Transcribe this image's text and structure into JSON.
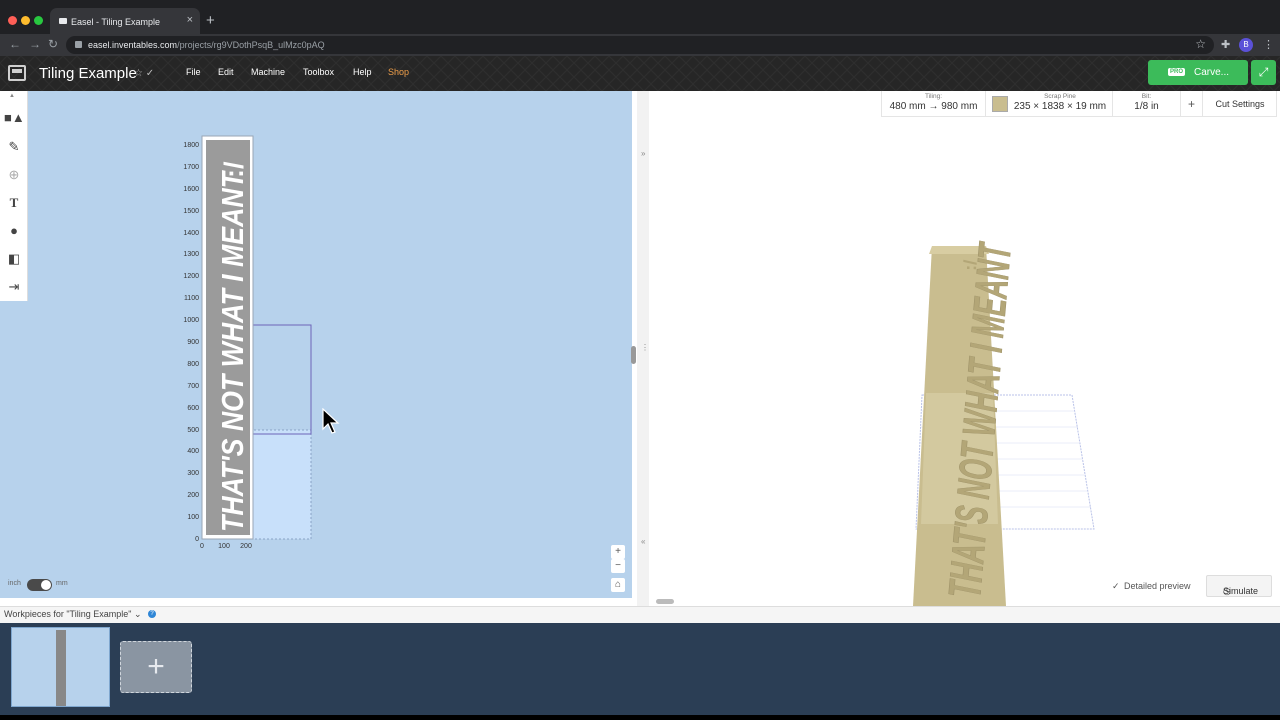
{
  "browser": {
    "tab_title": "Easel - Tiling Example",
    "tab_close": "×",
    "new_tab": "+",
    "url_host": "easel.inventables.com",
    "url_path": "/projects/rg9VDothPsqB_ulMzc0pAQ",
    "profile_initial": "B"
  },
  "app": {
    "project_title": "Tiling Example",
    "menu": [
      "File",
      "Edit",
      "Machine",
      "Toolbox",
      "Help",
      "Shop"
    ],
    "carve_pro": "PRO",
    "carve_label": "Carve..."
  },
  "info_bar": {
    "tiling_label": "Tiling:",
    "tiling_value": "480 mm → 980 mm",
    "material_label": "Scrap Pine",
    "material_value": "235 × 1838 × 19 mm",
    "bit_label": "Bit:",
    "bit_value": "1/8 in",
    "add_label": "+",
    "cut_settings": "Cut Settings"
  },
  "canvas": {
    "design_text": "THAT'S NOT WHAT I MEANT",
    "face_text": ":/",
    "y_ticks": [
      "1800",
      "1700",
      "1600",
      "1500",
      "1400",
      "1300",
      "1200",
      "1100",
      "1000",
      "900",
      "800",
      "700",
      "600",
      "500",
      "400",
      "300",
      "200",
      "100",
      "0"
    ],
    "x_ticks": [
      "0",
      "100",
      "200"
    ],
    "unit_inch": "inch",
    "unit_mm": "mm",
    "zoom_in": "+",
    "zoom_out": "−"
  },
  "preview": {
    "detailed_preview": "Detailed preview",
    "simulate": "Simulate",
    "wood_color": "#c9bd8f"
  },
  "workpieces": {
    "label": "Workpieces for \"Tiling Example\"",
    "help": "?",
    "add": "+"
  }
}
